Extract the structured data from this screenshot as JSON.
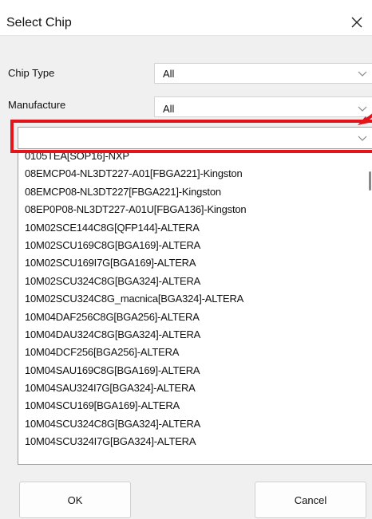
{
  "window": {
    "title": "Select Chip"
  },
  "form": {
    "chip_type_label": "Chip Type",
    "chip_type_value": "All",
    "manufacture_label": "Manufacture",
    "manufacture_value": "All",
    "search_value": ""
  },
  "chip_list": [
    "0105TEA[SOP16]-NXP",
    "08EMCP04-NL3DT227-A01[FBGA221]-Kingston",
    "08EMCP08-NL3DT227[FBGA221]-Kingston",
    "08EP0P08-NL3DT227-A01U[FBGA136]-Kingston",
    "10M02SCE144C8G[QFP144]-ALTERA",
    "10M02SCU169C8G[BGA169]-ALTERA",
    "10M02SCU169I7G[BGA169]-ALTERA",
    "10M02SCU324C8G[BGA324]-ALTERA",
    "10M02SCU324C8G_macnica[BGA324]-ALTERA",
    "10M04DAF256C8G[BGA256]-ALTERA",
    "10M04DAU324C8G[BGA324]-ALTERA",
    "10M04DCF256[BGA256]-ALTERA",
    "10M04SAU169C8G[BGA169]-ALTERA",
    "10M04SAU324I7G[BGA324]-ALTERA",
    "10M04SCU169[BGA169]-ALTERA",
    "10M04SCU324C8G[BGA324]-ALTERA",
    "10M04SCU324I7G[BGA324]-ALTERA"
  ],
  "buttons": {
    "ok_label": "OK",
    "cancel_label": "Cancel"
  },
  "icons": {
    "close": "close-icon",
    "dropdown": "chevron-down-icon",
    "annotation": "red-arrow-annotation"
  },
  "colors": {
    "highlight": "#e4141b",
    "background": "#f0f0f0"
  }
}
